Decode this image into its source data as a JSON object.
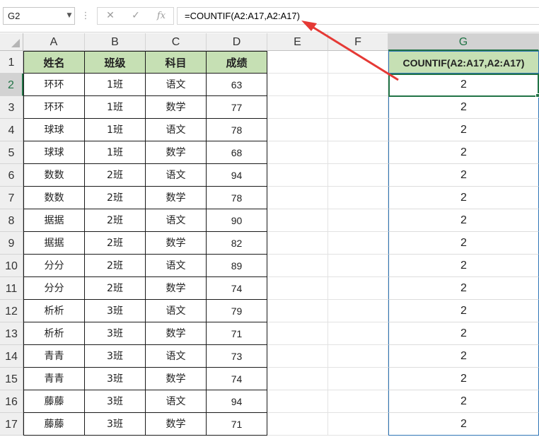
{
  "formula_bar": {
    "name_box": "G2",
    "cancel_icon": "✕",
    "enter_icon": "✓",
    "fx_label": "fx",
    "formula": "=COUNTIF(A2:A17,A2:A17)"
  },
  "columns": [
    "A",
    "B",
    "C",
    "D",
    "E",
    "F",
    "G"
  ],
  "rows": [
    "1",
    "2",
    "3",
    "4",
    "5",
    "6",
    "7",
    "8",
    "9",
    "10",
    "11",
    "12",
    "13",
    "14",
    "15",
    "16",
    "17"
  ],
  "table": {
    "headers": [
      "姓名",
      "班级",
      "科目",
      "成绩"
    ],
    "data": [
      [
        "环环",
        "1班",
        "语文",
        "63"
      ],
      [
        "环环",
        "1班",
        "数学",
        "77"
      ],
      [
        "球球",
        "1班",
        "语文",
        "78"
      ],
      [
        "球球",
        "1班",
        "数学",
        "68"
      ],
      [
        "数数",
        "2班",
        "语文",
        "94"
      ],
      [
        "数数",
        "2班",
        "数学",
        "78"
      ],
      [
        "据据",
        "2班",
        "语文",
        "90"
      ],
      [
        "据据",
        "2班",
        "数学",
        "82"
      ],
      [
        "分分",
        "2班",
        "语文",
        "89"
      ],
      [
        "分分",
        "2班",
        "数学",
        "74"
      ],
      [
        "析析",
        "3班",
        "语文",
        "79"
      ],
      [
        "析析",
        "3班",
        "数学",
        "71"
      ],
      [
        "青青",
        "3班",
        "语文",
        "73"
      ],
      [
        "青青",
        "3班",
        "数学",
        "74"
      ],
      [
        "藤藤",
        "3班",
        "语文",
        "94"
      ],
      [
        "藤藤",
        "3班",
        "数学",
        "71"
      ]
    ]
  },
  "result_column": {
    "header": "COUNTIF(A2:A17,A2:A17)",
    "values": [
      "2",
      "2",
      "2",
      "2",
      "2",
      "2",
      "2",
      "2",
      "2",
      "2",
      "2",
      "2",
      "2",
      "2",
      "2",
      "2"
    ]
  },
  "selection": {
    "active_cell": "G2",
    "active_column": "G",
    "active_row": "2"
  },
  "colors": {
    "header_fill": "#c6e0b4",
    "selection_green": "#217346",
    "range_blue": "#2e75b6",
    "annotation_arrow": "#e53935"
  }
}
